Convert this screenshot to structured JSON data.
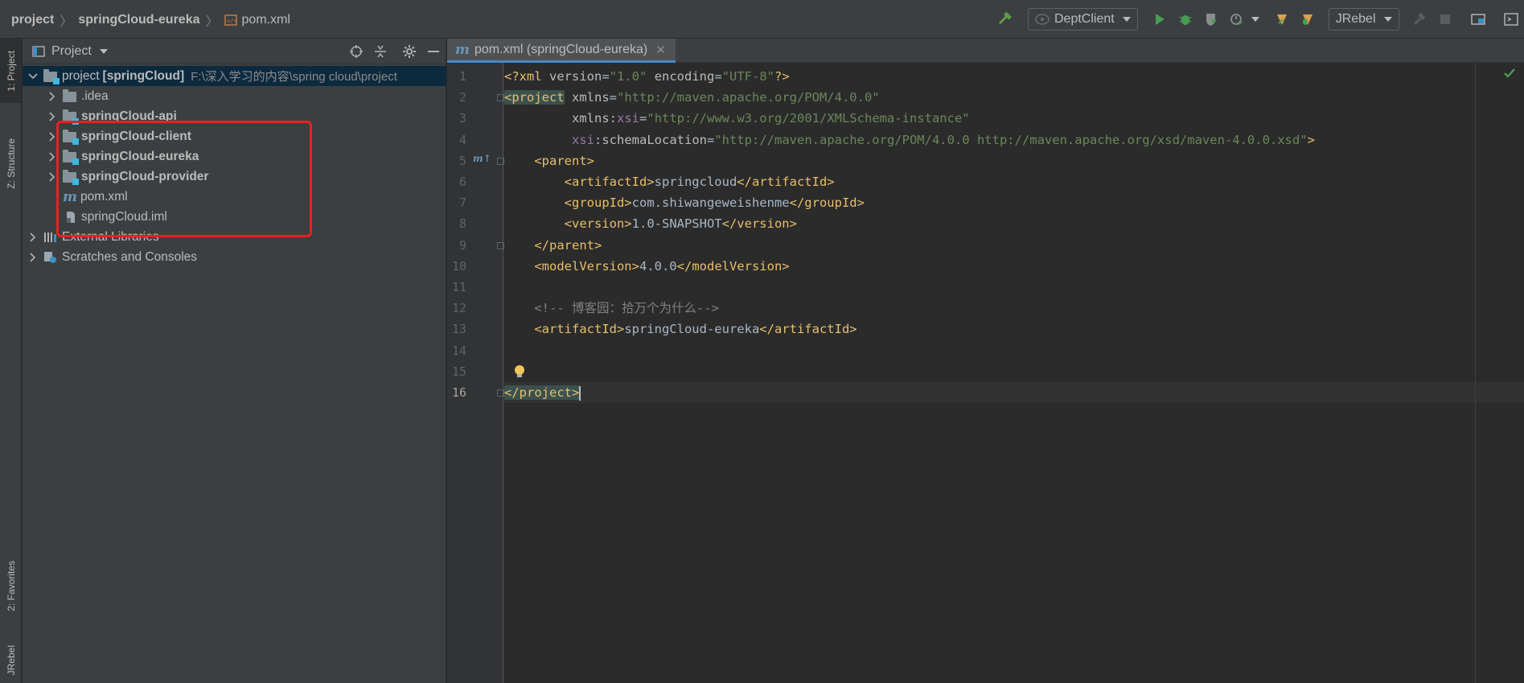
{
  "breadcrumbs": [
    "project",
    "springCloud-eureka",
    "pom.xml"
  ],
  "toolbar": {
    "run_config": "DeptClient",
    "jrebel": "JRebel"
  },
  "left_strip": {
    "project_tab": "1: Project",
    "structure_tab": "Z: Structure",
    "favorites_tab": "2: Favorites",
    "jrebel_tab": "JRebel"
  },
  "project_panel": {
    "title": "Project",
    "root": {
      "name": "project",
      "module": "[springCloud]",
      "path": "F:\\深入学习的内容\\spring cloud\\project"
    },
    "children": [
      {
        "name": ".idea",
        "bold": false
      },
      {
        "name": "springCloud-api",
        "bold": true
      },
      {
        "name": "springCloud-client",
        "bold": true
      },
      {
        "name": "springCloud-eureka",
        "bold": true
      },
      {
        "name": "springCloud-provider",
        "bold": true
      }
    ],
    "files": [
      "pom.xml",
      "springCloud.iml"
    ],
    "external_libraries": "External Libraries",
    "scratches": "Scratches and Consoles"
  },
  "editor": {
    "tab_label": "pom.xml (springCloud-eureka)",
    "current_line": 16,
    "lines": [
      [
        [
          "decl",
          "<?xml "
        ],
        [
          "attr",
          "version"
        ],
        [
          "txt",
          "="
        ],
        [
          "val",
          "\"1.0\""
        ],
        [
          "txt",
          " "
        ],
        [
          "attr",
          "encoding"
        ],
        [
          "txt",
          "="
        ],
        [
          "val",
          "\"UTF-8\""
        ],
        [
          "decl",
          "?>"
        ]
      ],
      [
        [
          "taghl",
          "<project"
        ],
        [
          "txt",
          " "
        ],
        [
          "attr",
          "xmlns"
        ],
        [
          "txt",
          "="
        ],
        [
          "val",
          "\"http://maven.apache.org/POM/4.0.0\""
        ]
      ],
      [
        [
          "txt",
          "         "
        ],
        [
          "attr",
          "xmlns"
        ],
        [
          "txt",
          ":"
        ],
        [
          "ns",
          "xsi"
        ],
        [
          "txt",
          "="
        ],
        [
          "val",
          "\"http://www.w3.org/2001/XMLSchema-instance\""
        ]
      ],
      [
        [
          "txt",
          "         "
        ],
        [
          "ns",
          "xsi"
        ],
        [
          "txt",
          ":"
        ],
        [
          "attr",
          "schemaLocation"
        ],
        [
          "txt",
          "="
        ],
        [
          "val",
          "\"http://maven.apache.org/POM/4.0.0 http://maven.apache.org/xsd/maven-4.0.0.xsd\""
        ],
        [
          "tag",
          ">"
        ]
      ],
      [
        [
          "txt",
          "    "
        ],
        [
          "tag",
          "<parent>"
        ]
      ],
      [
        [
          "txt",
          "        "
        ],
        [
          "tag",
          "<artifactId>"
        ],
        [
          "txt",
          "springcloud"
        ],
        [
          "tag",
          "</artifactId>"
        ]
      ],
      [
        [
          "txt",
          "        "
        ],
        [
          "tag",
          "<groupId>"
        ],
        [
          "txt",
          "com.shiwangeweishenme"
        ],
        [
          "tag",
          "</groupId>"
        ]
      ],
      [
        [
          "txt",
          "        "
        ],
        [
          "tag",
          "<version>"
        ],
        [
          "txt",
          "1.0-SNAPSHOT"
        ],
        [
          "tag",
          "</version>"
        ]
      ],
      [
        [
          "txt",
          "    "
        ],
        [
          "tag",
          "</parent>"
        ]
      ],
      [
        [
          "txt",
          "    "
        ],
        [
          "tag",
          "<modelVersion>"
        ],
        [
          "txt",
          "4.0.0"
        ],
        [
          "tag",
          "</modelVersion>"
        ]
      ],
      [],
      [
        [
          "txt",
          "    "
        ],
        [
          "cmt",
          "<!-- 博客园：拾万个为什么-->"
        ]
      ],
      [
        [
          "txt",
          "    "
        ],
        [
          "tag",
          "<artifactId>"
        ],
        [
          "txt",
          "springCloud-eureka"
        ],
        [
          "tag",
          "</artifactId>"
        ]
      ],
      [],
      [],
      [
        [
          "taghl",
          "</project>"
        ],
        [
          "caret",
          ""
        ]
      ]
    ]
  },
  "colors": {
    "bg_editor": "#2b2b2b",
    "bg_panel": "#3c3f41",
    "xml_tag": "#e8bf6a",
    "xml_value": "#6a8759",
    "comment": "#808080",
    "highlight_box": "#e8221e",
    "selection": "#0d293e"
  }
}
